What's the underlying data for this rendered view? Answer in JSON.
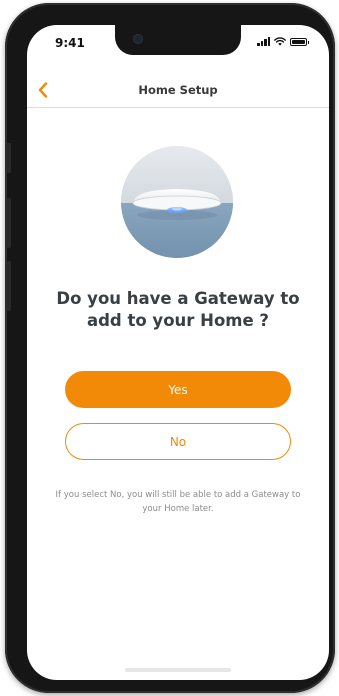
{
  "status_bar": {
    "time": "9:41",
    "icons": [
      "signal-icon",
      "wifi-icon",
      "battery-icon"
    ]
  },
  "nav": {
    "back_icon": "chevron-left-icon",
    "title": "Home Setup"
  },
  "hero": {
    "image": "gateway-device-illustration"
  },
  "question": "Do you have a Gateway to add to your Home ?",
  "buttons": {
    "yes_label": "Yes",
    "no_label": "No"
  },
  "note": "If you select No, you will still be able to add a Gateway to your Home later.",
  "colors": {
    "accent": "#f28a07",
    "title_text": "#3a3f44",
    "note_text": "#8c8c8c",
    "hero_water": "#7f9cb7",
    "hero_sky": "#dde2e8"
  }
}
